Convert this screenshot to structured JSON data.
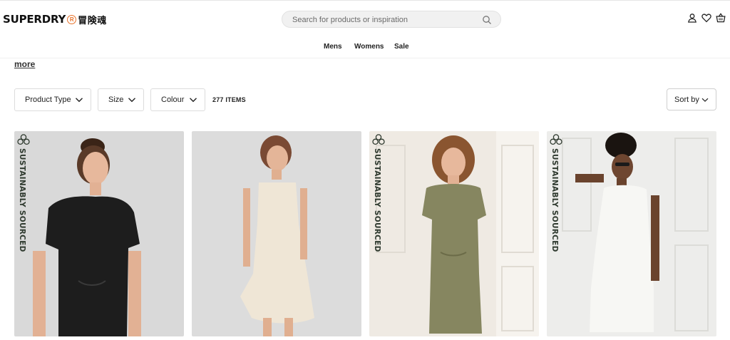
{
  "header": {
    "logo_text": "SUPERDRY",
    "logo_reg_mark": "R",
    "logo_cjk": "冒険魂",
    "search_placeholder": "Search for products or inspiration",
    "icons": [
      "user-icon",
      "heart-icon",
      "basket-icon"
    ]
  },
  "nav": {
    "items": [
      {
        "label": "Mens"
      },
      {
        "label": "Womens"
      },
      {
        "label": "Sale"
      }
    ]
  },
  "content": {
    "more_link": "more",
    "filters": [
      {
        "label": "Product Type"
      },
      {
        "label": "Size"
      },
      {
        "label": "Colour"
      }
    ],
    "items_count": "277 ITEMS",
    "sort_label": "Sort by"
  },
  "products": [
    {
      "badge": "SUSTAINABLY SOURCED",
      "dress_color": "#1d1d1d",
      "bg": "#d9d9d9"
    },
    {
      "badge": "",
      "dress_color": "#efe6d6",
      "bg": "#dcdcdc"
    },
    {
      "badge": "SUSTAINABLY SOURCED",
      "dress_color": "#868660",
      "bg": "#efeae3"
    },
    {
      "badge": "SUSTAINABLY SOURCED",
      "dress_color": "#f7f7f4",
      "bg": "#ededeb"
    }
  ],
  "colors": {
    "logo_accent": "#e8722a",
    "badge_text": "#2f3a2f"
  }
}
